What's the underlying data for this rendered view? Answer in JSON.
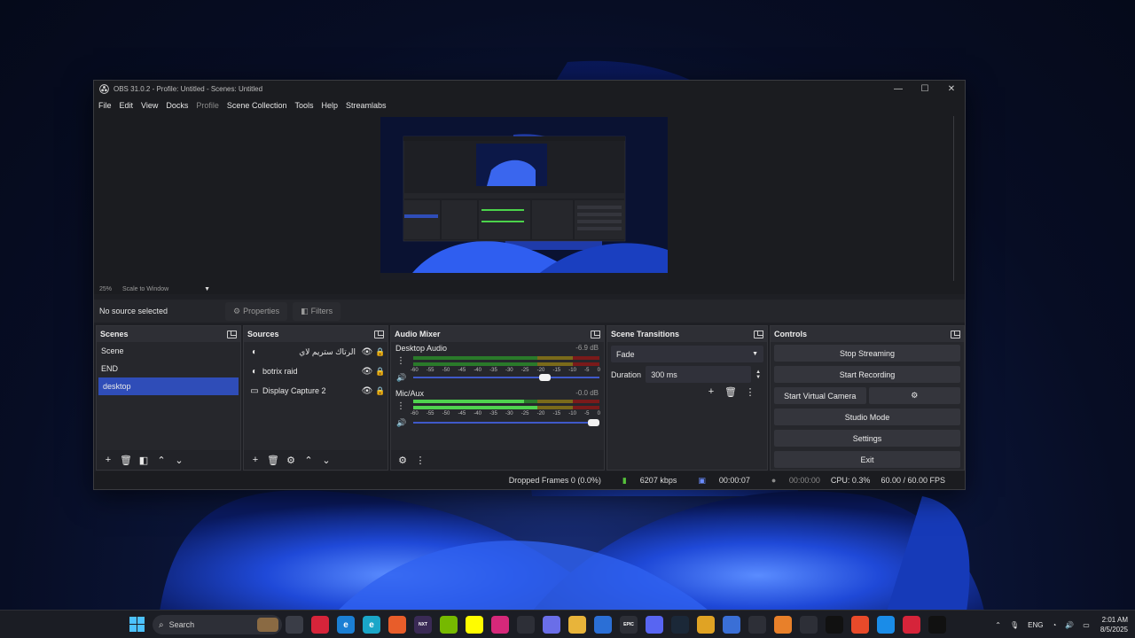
{
  "window": {
    "title": "OBS 31.0.2 - Profile: Untitled - Scenes: Untitled",
    "controls": [
      "—",
      "☐",
      "✕"
    ]
  },
  "menu": [
    "File",
    "Edit",
    "View",
    "Docks",
    "Profile",
    "Scene Collection",
    "Tools",
    "Help",
    "Streamlabs"
  ],
  "preview": {
    "zoom": "25%",
    "scale_mode": "Scale to Window"
  },
  "source_bar": {
    "status": "No source selected",
    "properties": "Properties",
    "filters": "Filters"
  },
  "scenes": {
    "title": "Scenes",
    "items": [
      {
        "label": "Scene",
        "selected": false
      },
      {
        "label": "END",
        "selected": false
      },
      {
        "label": "desktop",
        "selected": true
      }
    ]
  },
  "sources": {
    "title": "Sources",
    "items": [
      {
        "label": "الرتاك ستريم لاي",
        "icon": "browser-icon"
      },
      {
        "label": "botrix raid",
        "icon": "browser-icon"
      },
      {
        "label": "Display Capture 2",
        "icon": "monitor-icon"
      }
    ]
  },
  "mixer": {
    "title": "Audio Mixer",
    "channels": [
      {
        "name": "Desktop Audio",
        "db": "-6.9 dB",
        "volume": 0.72
      },
      {
        "name": "Mic/Aux",
        "db": "-0.0 dB",
        "volume": 1.0
      }
    ],
    "ticks": [
      "-60",
      "-55",
      "-50",
      "-45",
      "-40",
      "-35",
      "-30",
      "-25",
      "-20",
      "-15",
      "-10",
      "-5",
      "0"
    ]
  },
  "transitions": {
    "title": "Scene Transitions",
    "type": "Fade",
    "duration_label": "Duration",
    "duration": "300 ms"
  },
  "controls": {
    "title": "Controls",
    "stop_streaming": "Stop Streaming",
    "start_recording": "Start Recording",
    "start_virtual_camera": "Start Virtual Camera",
    "studio_mode": "Studio Mode",
    "settings": "Settings",
    "exit": "Exit"
  },
  "status": {
    "dropped": "Dropped Frames 0 (0.0%)",
    "bitrate": "6207 kbps",
    "stream_time": "00:00:07",
    "record_time": "00:00:00",
    "cpu": "CPU: 0.3%",
    "fps": "60.00 / 60.00 FPS"
  },
  "taskbar": {
    "search": "Search",
    "lang": "ENG",
    "time": "2:01 AM",
    "date": "8/5/2025",
    "apps": [
      {
        "name": "file-viewer-icon",
        "color": "#3a3d47",
        "glyph": ""
      },
      {
        "name": "app-red-icon",
        "color": "#d6243a",
        "glyph": ""
      },
      {
        "name": "edge-icon",
        "color": "#1b7fd4",
        "glyph": "e"
      },
      {
        "name": "edge-beta-icon",
        "color": "#1aa6c8",
        "glyph": "e"
      },
      {
        "name": "colorful-app-icon",
        "color": "#e85d2a",
        "glyph": ""
      },
      {
        "name": "next-icon",
        "color": "#3a2a55",
        "glyph": "NXT"
      },
      {
        "name": "nvidia-icon",
        "color": "#76b900",
        "glyph": ""
      },
      {
        "name": "snapchat-icon",
        "color": "#fffc00",
        "glyph": ""
      },
      {
        "name": "instagram-icon",
        "color": "#d6287a",
        "glyph": ""
      },
      {
        "name": "nvidia-app-icon",
        "color": "#2d2f37",
        "glyph": ""
      },
      {
        "name": "copilot-icon",
        "color": "#6a6ee8",
        "glyph": ""
      },
      {
        "name": "folder-icon",
        "color": "#e8b43a",
        "glyph": ""
      },
      {
        "name": "store-icon",
        "color": "#2b6fd6",
        "glyph": ""
      },
      {
        "name": "epic-games-icon",
        "color": "#2d2f37",
        "glyph": "EPIC"
      },
      {
        "name": "discord-icon",
        "color": "#5865f2",
        "glyph": ""
      },
      {
        "name": "steam-icon",
        "color": "#1b2838",
        "glyph": ""
      },
      {
        "name": "chrome-icon",
        "color": "#e0a324",
        "glyph": ""
      },
      {
        "name": "shield-app-icon",
        "color": "#3a6fd6",
        "glyph": ""
      },
      {
        "name": "mail-app-icon",
        "color": "#2d2f37",
        "glyph": ""
      },
      {
        "name": "vlc-icon",
        "color": "#e8802a",
        "glyph": ""
      },
      {
        "name": "obs-icon",
        "color": "#2d2f37",
        "glyph": ""
      },
      {
        "name": "tiktok-icon",
        "color": "#111111",
        "glyph": ""
      },
      {
        "name": "app-orange-icon",
        "color": "#e84a2a",
        "glyph": ""
      },
      {
        "name": "app-blue-icon",
        "color": "#1a8ce8",
        "glyph": ""
      },
      {
        "name": "capcut-icon",
        "color": "#d6243a",
        "glyph": ""
      },
      {
        "name": "app-dark-icon",
        "color": "#111111",
        "glyph": ""
      }
    ]
  }
}
